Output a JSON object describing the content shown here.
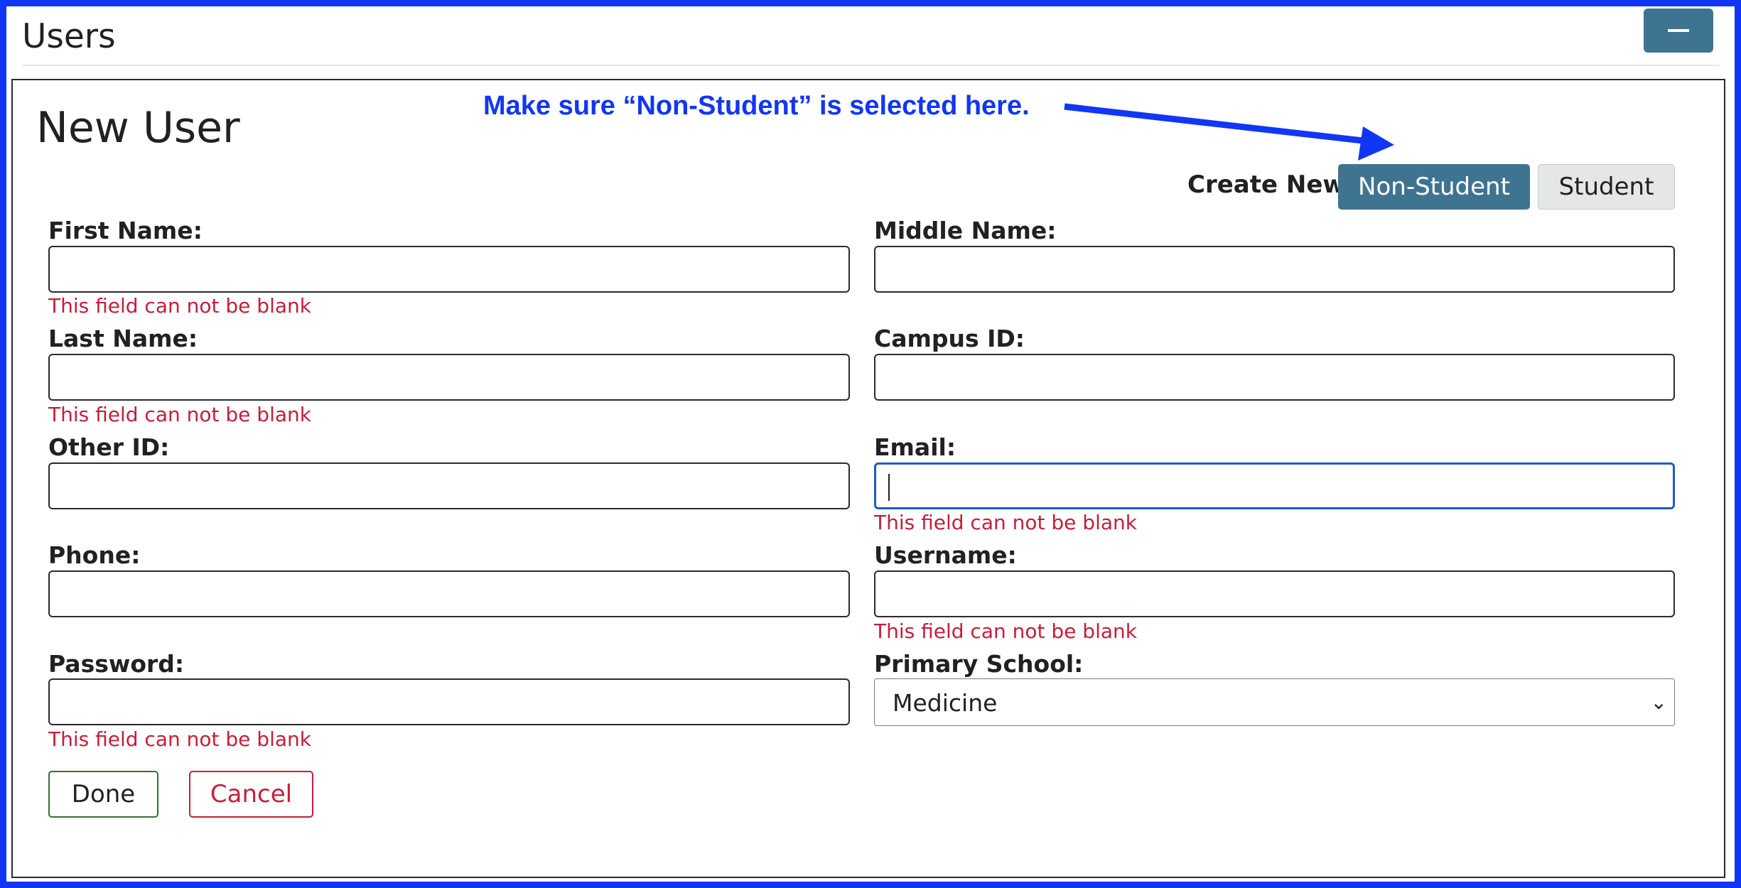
{
  "panel": {
    "title": "Users"
  },
  "form": {
    "heading": "New User",
    "annotation": "Make sure “Non-Student” is selected here.",
    "create_new": {
      "label": "Create New:",
      "options": [
        "Non-Student",
        "Student"
      ],
      "selected": "Non-Student"
    },
    "fields": {
      "first_name": {
        "label": "First Name:",
        "value": "",
        "error": "This field can not be blank"
      },
      "middle_name": {
        "label": "Middle Name:",
        "value": ""
      },
      "last_name": {
        "label": "Last Name:",
        "value": "",
        "error": "This field can not be blank"
      },
      "campus_id": {
        "label": "Campus ID:",
        "value": ""
      },
      "other_id": {
        "label": "Other ID:",
        "value": ""
      },
      "email": {
        "label": "Email:",
        "value": "",
        "error": "This field can not be blank"
      },
      "phone": {
        "label": "Phone:",
        "value": ""
      },
      "username": {
        "label": "Username:",
        "value": "",
        "error": "This field can not be blank"
      },
      "password": {
        "label": "Password:",
        "value": "",
        "error": "This field can not be blank"
      },
      "primary_school": {
        "label": "Primary School:",
        "selected": "Medicine"
      }
    },
    "buttons": {
      "done": "Done",
      "cancel": "Cancel"
    }
  },
  "icons": {
    "minimize": "minus-icon",
    "select_arrow": "chevron-down-icon",
    "annotation_arrow": "arrow-icon"
  },
  "colors": {
    "frame": "#1136f5",
    "primary": "#3f7490",
    "error": "#c41f3b",
    "focus": "#1f5bc7"
  }
}
